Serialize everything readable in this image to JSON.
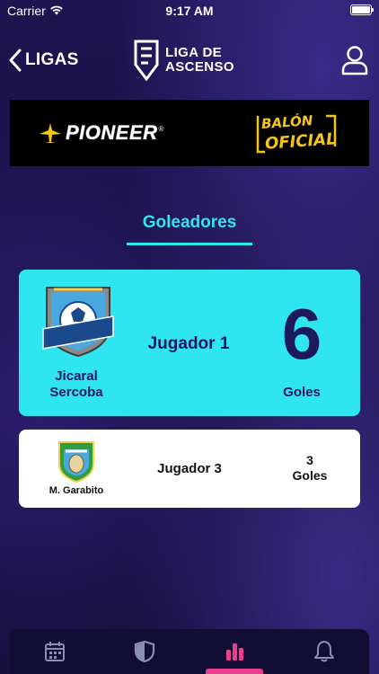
{
  "status_bar": {
    "carrier": "Carrier",
    "time": "9:17 AM",
    "battery_level": 1.0
  },
  "header": {
    "back_label": "LIGAS",
    "logo_line1": "LIGA DE",
    "logo_line2": "ASCENSO",
    "profile_icon": "user-icon"
  },
  "sponsor": {
    "brand1": "PIONEER",
    "brand1_mark": "®",
    "brand2_line1": "BALÓN",
    "brand2_line2": "OFICIAL"
  },
  "tab": {
    "label": "Goleadores"
  },
  "scorers": [
    {
      "team": "Jicaral Sercoba",
      "player": "Jugador 1",
      "goals": "6",
      "goals_label": "Goles"
    },
    {
      "team": "M. Garabito",
      "player": "Jugador 3",
      "goals": "3",
      "goals_label": "Goles"
    }
  ],
  "bottom_nav": {
    "items": [
      {
        "icon": "calendar-icon",
        "active": false
      },
      {
        "icon": "shield-icon",
        "active": false
      },
      {
        "icon": "stats-icon",
        "active": true
      },
      {
        "icon": "bell-icon",
        "active": false
      }
    ]
  },
  "colors": {
    "accent": "#2ee5f0",
    "active_tab": "#e83e8c",
    "dark_text": "#1d1a5c",
    "balon_yellow": "#f5c518"
  }
}
